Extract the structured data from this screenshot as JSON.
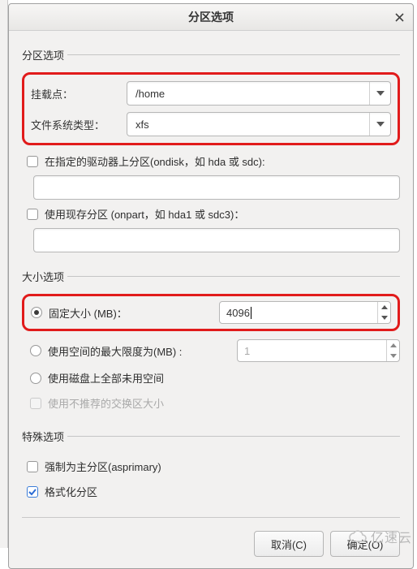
{
  "window": {
    "title": "分区选项"
  },
  "groups": {
    "partition": {
      "legend": "分区选项",
      "mountpoint_label": "挂载点：",
      "mountpoint_value": "/home",
      "fstype_label": "文件系统类型：",
      "fstype_value": "xfs",
      "ondisk_label": "在指定的驱动器上分区(ondisk，如 hda 或 sdc):",
      "ondisk_value": "",
      "onpart_label": "使用现存分区 (onpart，如 hda1 或 sdc3)：",
      "onpart_value": ""
    },
    "size": {
      "legend": "大小选项",
      "fixed_label": "固定大小 (MB)：",
      "fixed_value": "4096",
      "maxsize_label": "使用空间的最大限度为(MB) :",
      "maxsize_value": "1",
      "grow_label": "使用磁盘上全部未用空间",
      "recommended_label": "使用不推荐的交换区大小"
    },
    "special": {
      "legend": "特殊选项",
      "asprimary_label": "强制为主分区(asprimary)",
      "format_label": "格式化分区"
    }
  },
  "buttons": {
    "cancel": "取消(C)",
    "ok": "确定(O)"
  },
  "watermark": "亿速云"
}
